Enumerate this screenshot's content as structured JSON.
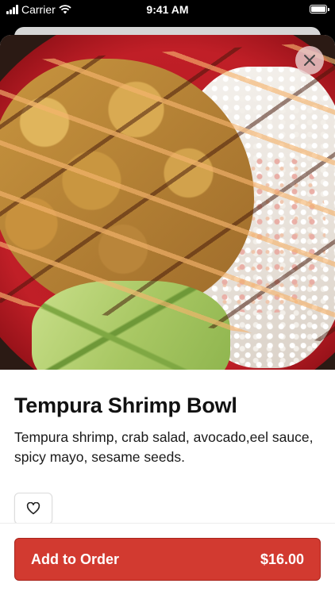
{
  "status_bar": {
    "carrier": "Carrier",
    "time": "9:41 AM"
  },
  "item": {
    "title": "Tempura Shrimp Bowl",
    "description": "Tempura shrimp, crab salad, avocado,eel sauce, spicy mayo, sesame seeds.",
    "favorite_icon": "heart-outline-icon",
    "close_icon": "close-icon"
  },
  "order": {
    "button_label": "Add to Order",
    "price": "$16.00"
  },
  "colors": {
    "accent": "#d23a30"
  }
}
